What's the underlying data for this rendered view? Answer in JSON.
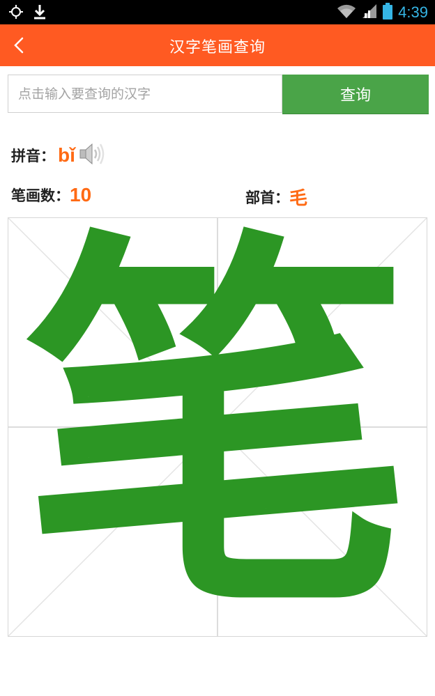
{
  "status_bar": {
    "time": "4:39",
    "icons": [
      "location-icon",
      "download-icon",
      "wifi-icon",
      "signal-icon",
      "battery-icon"
    ]
  },
  "header": {
    "title": "汉字笔画查询",
    "background": "#ff5a22"
  },
  "search": {
    "placeholder": "点击输入要查询的汉字",
    "value": "",
    "button_label": "查询",
    "button_color": "#4aa448"
  },
  "result": {
    "pinyin_label": "拼音：",
    "pinyin": "bǐ",
    "strokes_label": "笔画数：",
    "strokes": "10",
    "radical_label": "部首：",
    "radical": "毛",
    "character": "笔",
    "character_color": "#2c9624",
    "accent_color": "#ff6a14"
  }
}
